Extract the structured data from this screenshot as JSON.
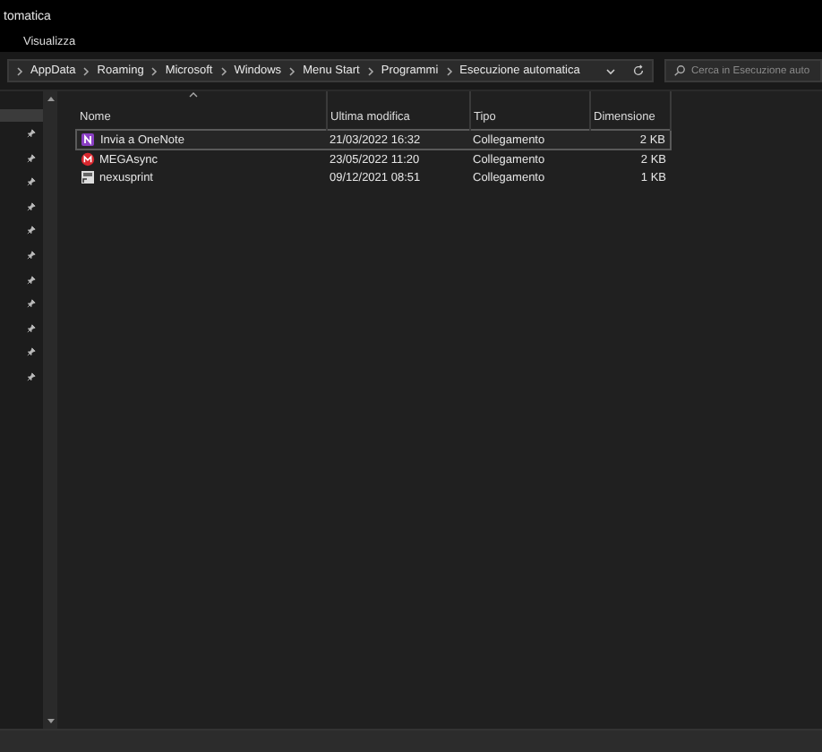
{
  "window": {
    "title": "tomatica"
  },
  "menu": [
    "Visualizza"
  ],
  "address": {
    "crumbs": [
      "AppData",
      "Roaming",
      "Microsoft",
      "Windows",
      "Menu Start",
      "Programmi",
      "Esecuzione automatica"
    ]
  },
  "search": {
    "placeholder": "Cerca in Esecuzione auto"
  },
  "nav": {
    "pinned_count_rows": [
      {
        "pinned": true
      },
      {
        "pinned": true
      },
      {
        "pinned": true
      },
      {
        "pinned": true
      },
      {
        "pinned": true
      },
      {
        "pinned": true
      },
      {
        "pinned": true
      },
      {
        "pinned": true
      },
      {
        "pinned": true
      },
      {
        "pinned": true
      },
      {
        "pinned": true
      }
    ]
  },
  "table": {
    "columns": [
      "Nome",
      "Ultima modifica",
      "Tipo",
      "Dimensione"
    ],
    "rows": [
      {
        "kind": "onenote",
        "name": "Invia a OneNote",
        "modified": "21/03/2022 16:32",
        "type": "Collegamento",
        "size": "2 KB",
        "selected": true
      },
      {
        "kind": "mega",
        "name": "MEGAsync",
        "modified": "23/05/2022 11:20",
        "type": "Collegamento",
        "size": "2 KB",
        "selected": false
      },
      {
        "kind": "generic",
        "name": "nexusprint",
        "modified": "09/12/2021 08:51",
        "type": "Collegamento",
        "size": "1 KB",
        "selected": false
      }
    ]
  }
}
